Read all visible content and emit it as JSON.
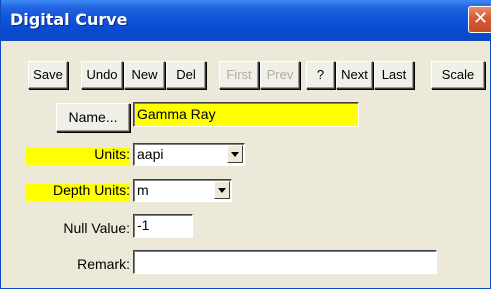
{
  "window": {
    "title": "Digital Curve",
    "close_symbol": "✕"
  },
  "toolbar": {
    "save_label": "Save",
    "undo_label": "Undo",
    "new_label": "New",
    "del_label": "Del",
    "first_label": "First",
    "prev_label": "Prev",
    "help_label": "?",
    "next_label": "Next",
    "last_label": "Last",
    "scale_label": "Scale"
  },
  "form": {
    "name_button_label": "Name...",
    "name_value": "Gamma Ray",
    "units_label": "Units:",
    "units_value": "aapi",
    "depth_units_label": "Depth Units:",
    "depth_units_value": "m",
    "null_value_label": "Null Value:",
    "null_value": "-1",
    "remark_label": "Remark:",
    "remark_value": ""
  },
  "colors": {
    "title_bar": "#0f54db",
    "highlight": "#ffff00",
    "face": "#ece9d8",
    "close_button": "#d65a35"
  },
  "icons": {
    "close": "close-icon",
    "dropdown": "chevron-down-icon"
  }
}
